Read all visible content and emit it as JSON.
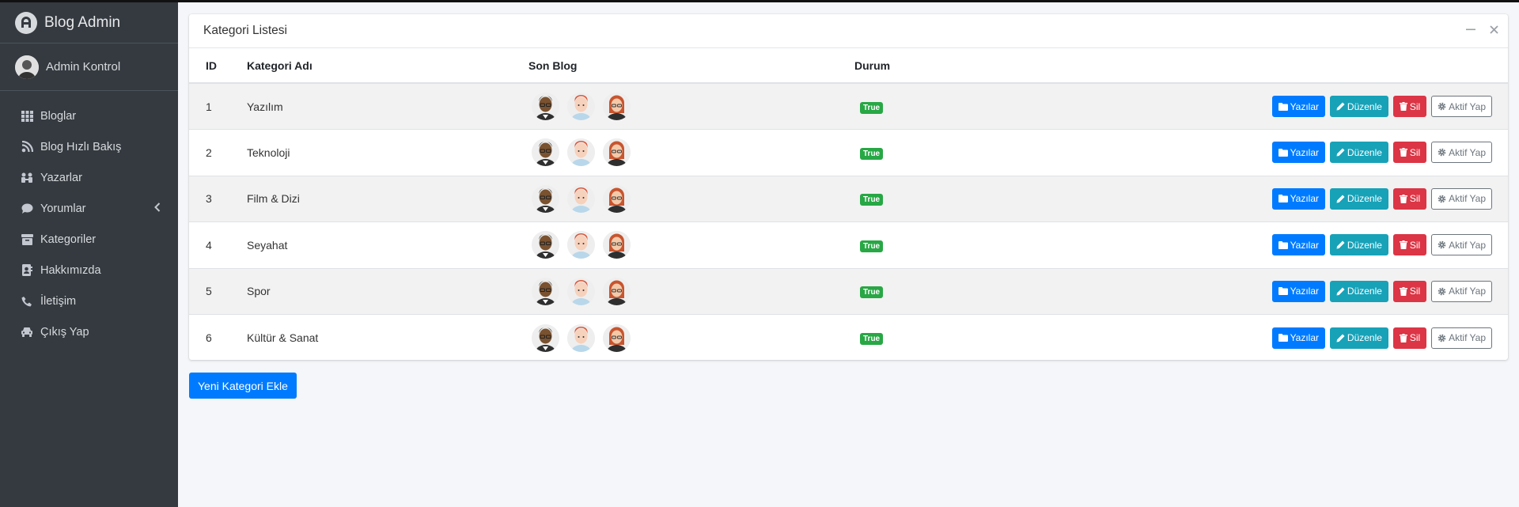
{
  "app": {
    "title": "Blog Admin"
  },
  "user": {
    "name": "Admin Kontrol"
  },
  "sidebar": {
    "items": [
      {
        "label": "Bloglar",
        "icon": "grid-icon"
      },
      {
        "label": "Blog Hızlı Bakış",
        "icon": "blog-icon"
      },
      {
        "label": "Yazarlar",
        "icon": "users-icon"
      },
      {
        "label": "Yorumlar",
        "icon": "comment-icon"
      },
      {
        "label": "Kategoriler",
        "icon": "archive-icon"
      },
      {
        "label": "Hakkımızda",
        "icon": "address-book-icon"
      },
      {
        "label": "İletişim",
        "icon": "phone-icon"
      },
      {
        "label": "Çıkış Yap",
        "icon": "car-icon"
      }
    ]
  },
  "card": {
    "title": "Kategori Listesi",
    "columns": {
      "id": "ID",
      "name": "Kategori Adı",
      "blog": "Son Blog",
      "status": "Durum"
    },
    "rows": [
      {
        "id": "1",
        "name": "Yazılım",
        "status": "True"
      },
      {
        "id": "2",
        "name": "Teknoloji",
        "status": "True"
      },
      {
        "id": "3",
        "name": "Film & Dizi",
        "status": "True"
      },
      {
        "id": "4",
        "name": "Seyahat",
        "status": "True"
      },
      {
        "id": "5",
        "name": "Spor",
        "status": "True"
      },
      {
        "id": "6",
        "name": "Kültür & Sanat",
        "status": "True"
      }
    ],
    "actions": {
      "posts": "Yazılar",
      "edit": "Düzenle",
      "delete": "Sil",
      "activate": "Aktif Yap"
    }
  },
  "add_button": "Yeni Kategori Ekle",
  "colors": {
    "primary": "#007bff",
    "info": "#17a2b8",
    "danger": "#dc3545",
    "success": "#28a745",
    "sidebar": "#343a40"
  }
}
